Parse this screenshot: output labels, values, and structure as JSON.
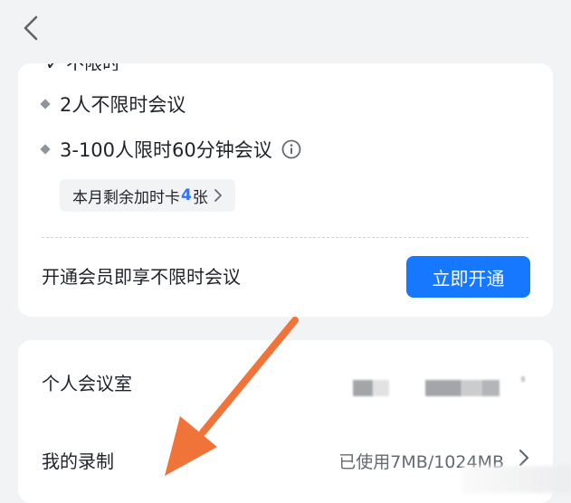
{
  "nav": {
    "back_icon": "chevron-left-icon"
  },
  "plan": {
    "partial_header": "✓ 不限时",
    "features": [
      {
        "label": "2人不限时会议"
      },
      {
        "label": "3-100人限时60分钟会议",
        "icon": "info-icon"
      }
    ],
    "extension_card": {
      "prefix": "本月剩余加时卡",
      "count": "4",
      "suffix": "张"
    },
    "promo_text": "开通会员即享不限时会议",
    "open_button_label": "立即开通"
  },
  "settings": {
    "rows": [
      {
        "label": "个人会议室"
      },
      {
        "label": "我的录制",
        "value": "已使用7MB/1024MB"
      }
    ]
  },
  "colors": {
    "accent": "#1677ff",
    "highlight": "#3370ff",
    "annotation_arrow": "#f0743a",
    "background": "#f2f3f5"
  }
}
